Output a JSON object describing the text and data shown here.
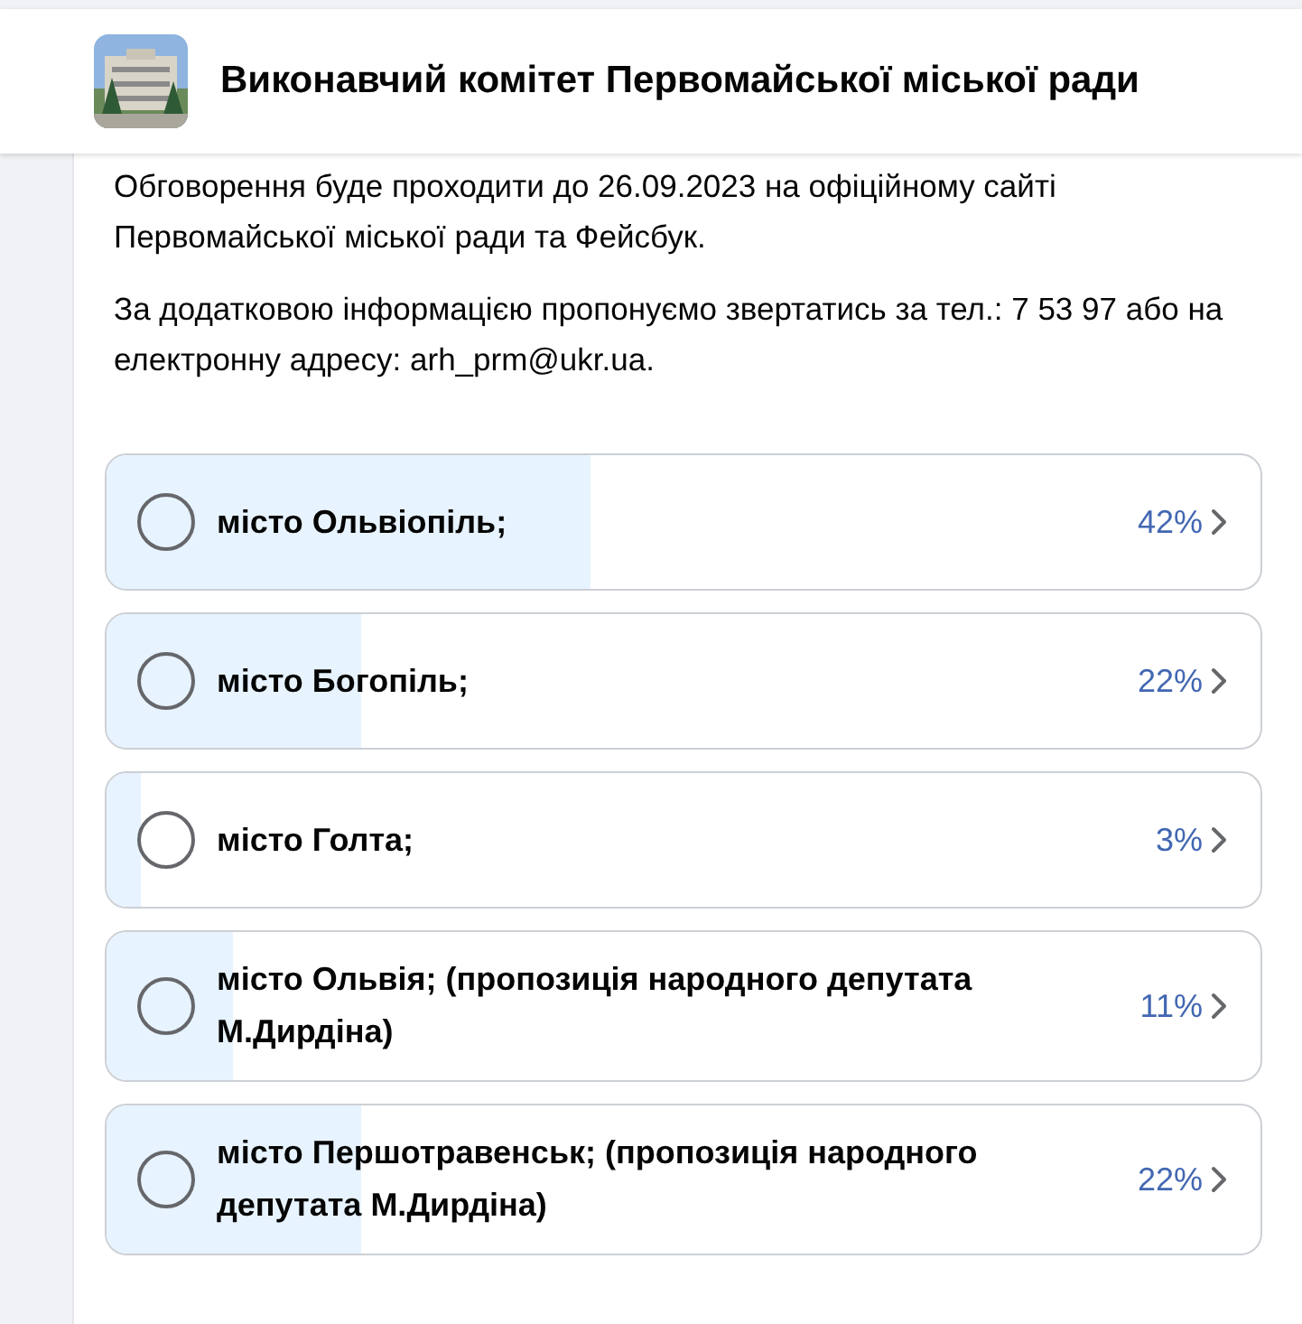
{
  "header": {
    "title": "Виконавчий комітет Первомайської міської ради"
  },
  "paragraphs": [
    "Обговорення буде проходити до 26.09.2023 на офіційному сайті Первомайської міської ради та Фейсбук.",
    "За додатковою інформацією пропонуємо звертатись за тел.: 7 53 97 або на електронну адресу: arh_prm@ukr.ua."
  ],
  "poll": {
    "options": [
      {
        "label": "місто Ольвіопіль;",
        "percent": "42%",
        "level": 0.42,
        "selected": false
      },
      {
        "label": "місто Богопіль;",
        "percent": "22%",
        "level": 0.22,
        "selected": false
      },
      {
        "label": "місто Голта;",
        "percent": "3%",
        "level": 0.03,
        "selected": false
      },
      {
        "label": "місто Ольвія; (пропозиція народного депутата М.Дирдіна)",
        "percent": "11%",
        "level": 0.11,
        "selected": false
      },
      {
        "label": "місто Першотравенськ; (пропозиція народного депутата М.Дирдіна)",
        "percent": "22%",
        "level": 0.22,
        "selected": false
      }
    ]
  }
}
